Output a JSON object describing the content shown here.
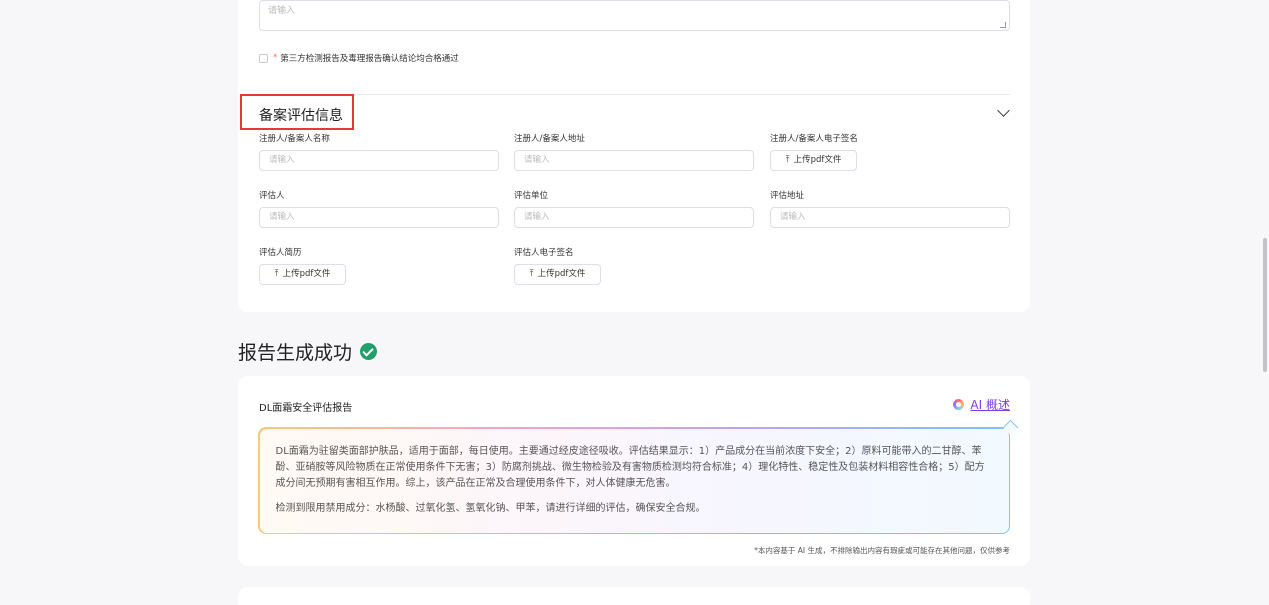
{
  "form": {
    "textarea_placeholder": "请输入",
    "confirm_checkbox_label": "第三方检测报告及毒理报告确认结论均合格通过",
    "required_mark": "*",
    "section_title": "备案评估信息",
    "fields": [
      {
        "label": "注册人/备案人名称",
        "placeholder": "请输入"
      },
      {
        "label": "注册人/备案人地址",
        "placeholder": "请输入"
      },
      {
        "label": "注册人/备案人电子签名",
        "upload_label": "上传pdf文件"
      },
      {
        "label": "评估人",
        "placeholder": "请输入"
      },
      {
        "label": "评估单位",
        "placeholder": "请输入"
      },
      {
        "label": "评估地址",
        "placeholder": "请输入"
      },
      {
        "label": "评估人简历",
        "upload_label": "上传pdf文件"
      },
      {
        "label": "评估人电子签名",
        "upload_label": "上传pdf文件"
      }
    ]
  },
  "success": {
    "title": "报告生成成功"
  },
  "report": {
    "title": "DL面霜安全评估报告",
    "ai_link": "AI 概述",
    "summary_p1": "DL面霜为驻留类面部护肤品，适用于面部，每日使用。主要通过经皮途径吸收。评估结果显示：1）产品成分在当前浓度下安全；2）原料可能带入的二甘醇、苯酚、亚硝胺等风险物质在正常使用条件下无害；3）防腐剂挑战、微生物检验及有害物质检测均符合标准；4）理化特性、稳定性及包装材料相容性合格；5）配方成分间无预期有害相互作用。综上，该产品在正常及合理使用条件下，对人体健康无危害。",
    "summary_p2": "检测到限用禁用成分：水杨酸、过氧化氢、氢氧化钠、甲苯，请进行详细的评估，确保安全合规。",
    "disclaimer": "*本内容基于 AI 生成，不排除输出内容有瑕疵或可能存在其他问题，仅供参考"
  },
  "colors": {
    "accent_purple": "#7b3fe4",
    "success_green": "#22a06b",
    "highlight_red": "#e53935"
  }
}
